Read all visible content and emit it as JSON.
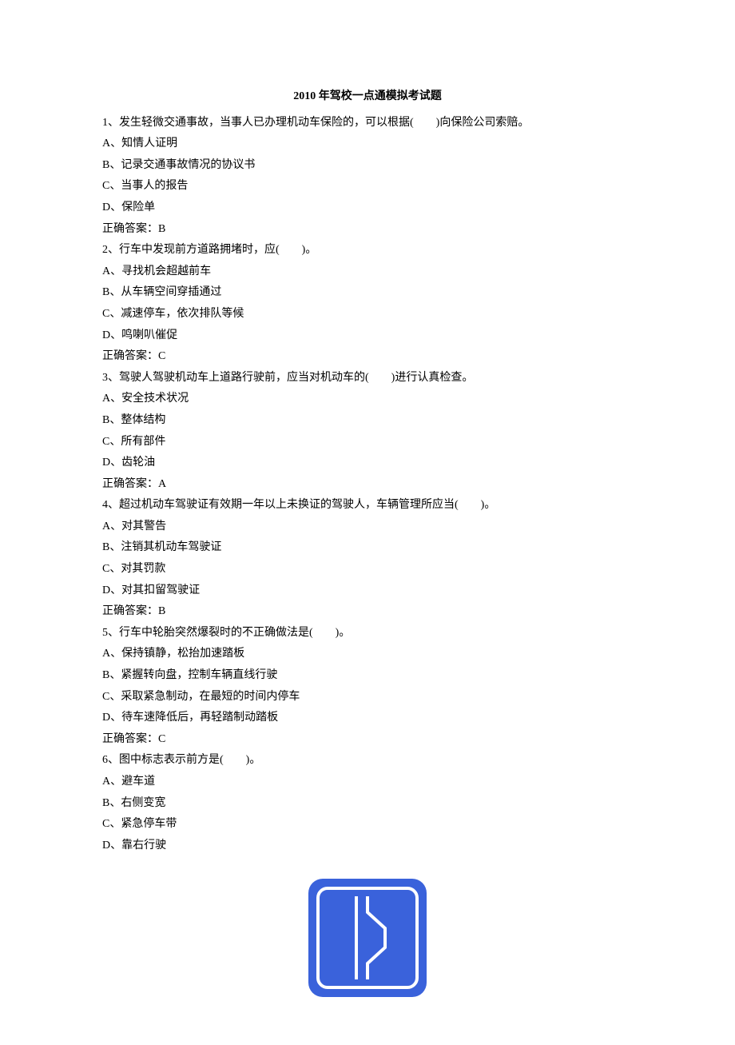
{
  "title": "2010 年驾校一点通模拟考试题",
  "questions": [
    {
      "stem": "1、发生轻微交通事故，当事人已办理机动车保险的，可以根据(　　)向保险公司索赔。",
      "options": [
        "A、知情人证明",
        "B、记录交通事故情况的协议书",
        "C、当事人的报告",
        "D、保险单"
      ],
      "answer": "正确答案：B"
    },
    {
      "stem": "2、行车中发现前方道路拥堵时，应(　　)。",
      "options": [
        "A、寻找机会超越前车",
        "B、从车辆空间穿插通过",
        "C、减速停车，依次排队等候",
        "D、鸣喇叭催促"
      ],
      "answer": "正确答案：C"
    },
    {
      "stem": "3、驾驶人驾驶机动车上道路行驶前，应当对机动车的(　　)进行认真检查。",
      "options": [
        "A、安全技术状况",
        "B、整体结构",
        "C、所有部件",
        "D、齿轮油"
      ],
      "answer": "正确答案：A"
    },
    {
      "stem": "4、超过机动车驾驶证有效期一年以上未换证的驾驶人，车辆管理所应当(　　)。",
      "options": [
        "A、对其警告",
        "B、注销其机动车驾驶证",
        "C、对其罚款",
        "D、对其扣留驾驶证"
      ],
      "answer": "正确答案：B"
    },
    {
      "stem": "5、行车中轮胎突然爆裂时的不正确做法是(　　)。",
      "options": [
        "A、保持镇静，松抬加速踏板",
        "B、紧握转向盘，控制车辆直线行驶",
        "C、采取紧急制动，在最短的时间内停车",
        "D、待车速降低后，再轻踏制动踏板"
      ],
      "answer": "正确答案：C"
    },
    {
      "stem": "6、图中标志表示前方是(　　)。",
      "options": [
        "A、避车道",
        "B、右侧变宽",
        "C、紧急停车带",
        "D、靠右行驶"
      ],
      "answer": null
    }
  ]
}
